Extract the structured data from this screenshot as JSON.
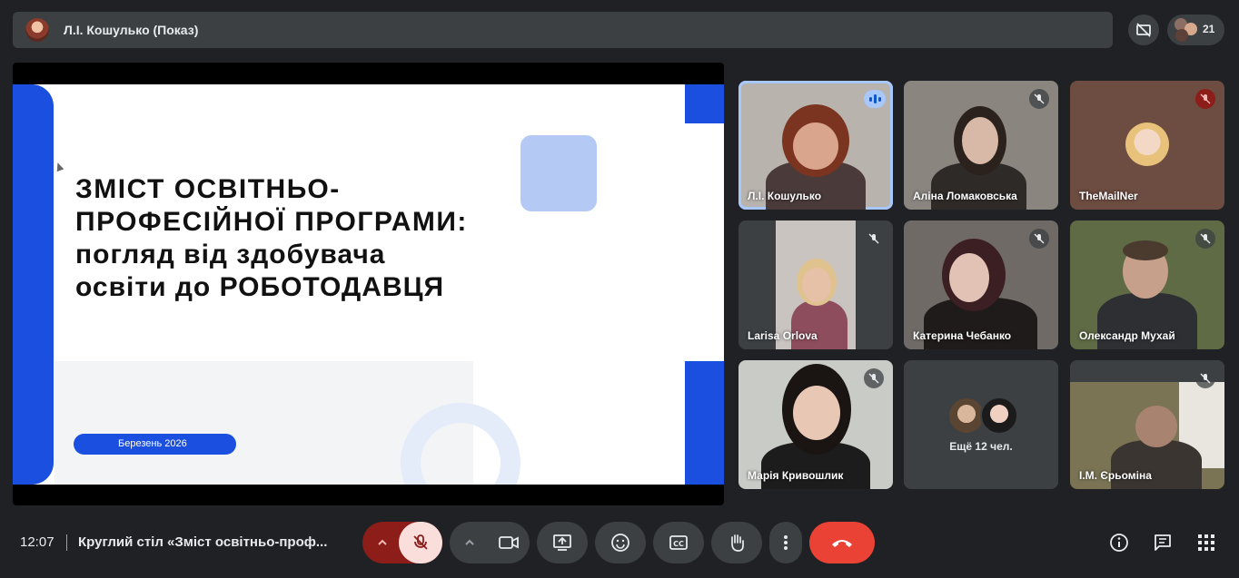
{
  "top_bar": {
    "presenter_label": "Л.І. Кошулько (Показ)",
    "participant_count": "21"
  },
  "slide": {
    "title_line1": "ЗМІСТ ОСВІТНЬО-",
    "title_line2": "ПРОФЕСІЙНОЇ ПРОГРАМИ:",
    "title_line3": "погляд від здобувача",
    "title_line4": "освіти до РОБОТОДАВЦЯ",
    "date_label": "Березень 2026"
  },
  "tiles": [
    {
      "name": "Л.І. Кошулько",
      "state": "speaking"
    },
    {
      "name": "Аліна Ломаковська",
      "state": "muted"
    },
    {
      "name": "TheMailNer",
      "state": "muted-red"
    },
    {
      "name": "Larisa Orlova",
      "state": "muted"
    },
    {
      "name": "Катерина Чебанко",
      "state": "muted"
    },
    {
      "name": "Олександр Мухай",
      "state": "muted"
    },
    {
      "name": "Марія Кривошлик",
      "state": "muted"
    },
    {
      "name": "Ещё 12 чел.",
      "state": "overflow"
    },
    {
      "name": "І.М. Єрьоміна",
      "state": "muted"
    }
  ],
  "bottom_bar": {
    "time": "12:07",
    "meeting_title": "Круглий стіл «Зміст освітньо-проф..."
  },
  "colors": {
    "background": "#202124",
    "leave_button": "#ea4335",
    "mic_muted_button": "#f9dedc",
    "slide_accent": "#1a4fe0"
  },
  "icons": [
    "presentation-off-icon",
    "mic-off-icon",
    "camera-icon",
    "present-screen-icon",
    "emoji-icon",
    "captions-icon",
    "raise-hand-icon",
    "more-options-icon",
    "hang-up-icon",
    "info-icon",
    "chat-icon",
    "activities-icon"
  ]
}
